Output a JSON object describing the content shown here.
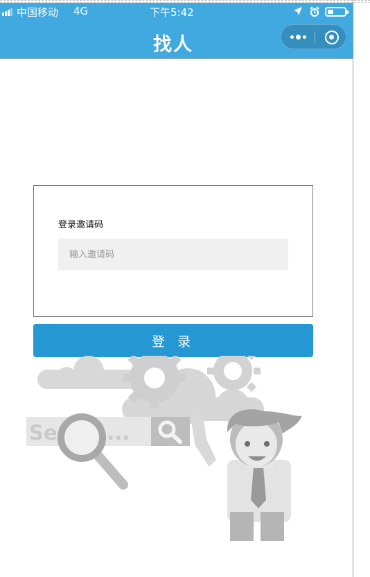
{
  "status_bar": {
    "carrier": "中国移动",
    "network": "4G",
    "time": "下午5:42"
  },
  "nav": {
    "title": "找人"
  },
  "login": {
    "label": "登录邀请码",
    "input_placeholder": "输入邀请码",
    "input_value": "",
    "button_label": "登 录"
  },
  "illustration": {
    "search_text": "Search..."
  },
  "colors": {
    "nav_bg": "#3fa9e0",
    "button_bg": "#2598d4",
    "input_bg": "#f0f0f0"
  }
}
